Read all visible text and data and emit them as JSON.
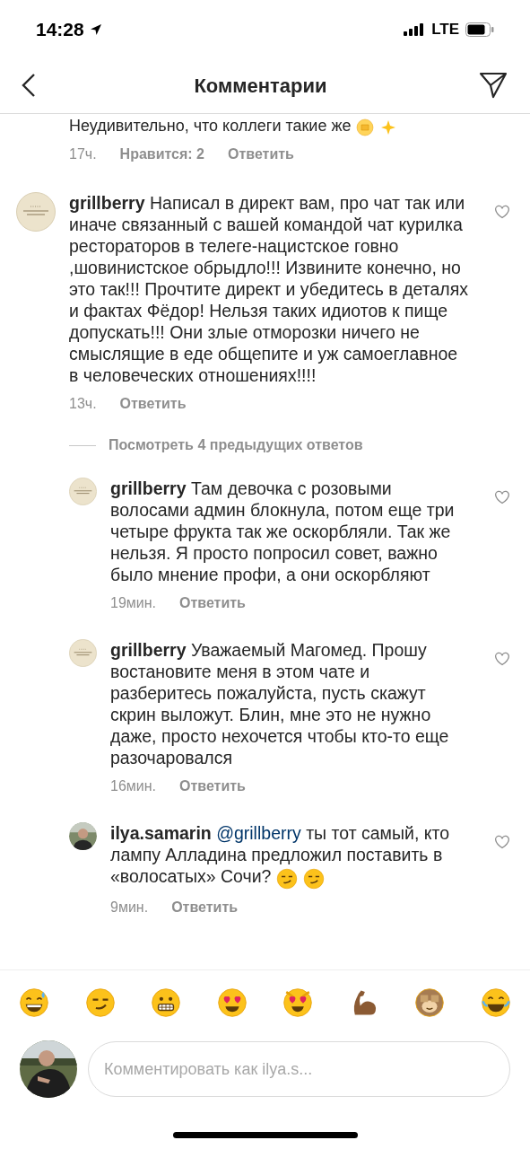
{
  "status_bar": {
    "time": "14:28",
    "network": "LTE"
  },
  "header": {
    "title": "Комментарии"
  },
  "partial_comment": {
    "text": "Неудивительно, что коллеги такие же",
    "trailing_emoji": [
      {
        "kind": "fist"
      },
      {
        "kind": "sparkle"
      }
    ],
    "time": "17ч.",
    "likes": "Нравится: 2",
    "reply": "Ответить"
  },
  "comments": [
    {
      "username": "grillberry",
      "kind": "logo",
      "text": "Написал в директ вам, про чат так или иначе связанный с вашей командой чат курилка рестораторов в телеге-нацистское говно ,шовинистское обрыдло!!! Извините конечно, но это так!!! Прочтите директ и убедитесь в деталях и фактах Фёдор! Нельзя таких идиотов к пище допускать!!! Они злые отморозки ничего не смыслящие в еде общепите и уж самоеглавное в человеческих отношениях!!!!",
      "time": "13ч.",
      "reply": "Ответить",
      "liked": false
    }
  ],
  "view_replies": "Посмотреть 4 предыдущих ответов",
  "replies": [
    {
      "username": "grillberry",
      "kind": "logo",
      "text": "Там девочка с розовыми волосами админ блокнула, потом еще три четыре фрукта так же оскорбляли. Так же нельзя. Я просто попросил совет, важно было мнение профи, а они оскорбляют",
      "time": "19мин.",
      "reply": "Ответить",
      "liked": false
    },
    {
      "username": "grillberry",
      "kind": "logo",
      "text": "Уважаемый Магомед. Прошу востановите меня в этом чате и разберитесь пожалуйста, пусть скажут скрин выложут. Блин, мне это не нужно даже, просто нехочется чтобы кто-то еще разочаровался",
      "time": "16мин.",
      "reply": "Ответить",
      "liked": false
    },
    {
      "username": "ilya.samarin",
      "kind": "picture",
      "mention": "@grillberry",
      "text": "ты тот самый, кто лампу Алладина предложил поставить в «волосатых» Сочи?",
      "trailing_emoji": [
        {
          "kind": "smirk"
        },
        {
          "kind": "smirk"
        }
      ],
      "time": "9мин.",
      "reply": "Ответить",
      "liked": false
    }
  ],
  "emoji_bar": [
    {
      "kind": "sweat"
    },
    {
      "kind": "smirk"
    },
    {
      "kind": "grimace"
    },
    {
      "kind": "hearteyes"
    },
    {
      "kind": "cat"
    },
    {
      "kind": "muscle"
    },
    {
      "kind": "monkey"
    },
    {
      "kind": "joy"
    }
  ],
  "composer": {
    "placeholder": "Комментировать как ilya.s..."
  }
}
